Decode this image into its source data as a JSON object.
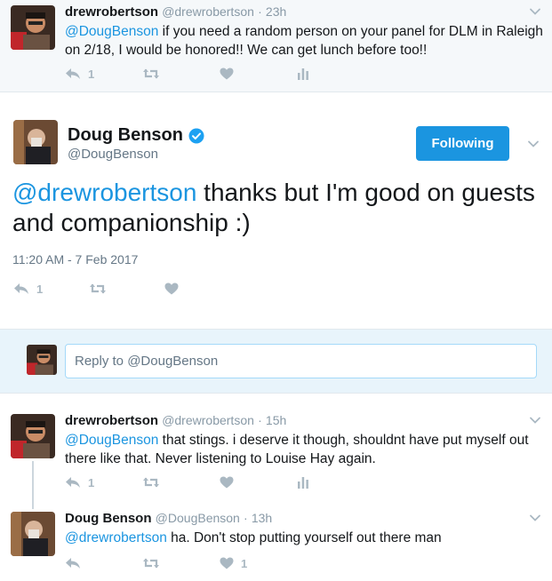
{
  "reply_top": {
    "name": "drewrobertson",
    "handle": "@drewrobertson",
    "dot": "·",
    "time": "23h",
    "mention": "@DougBenson",
    "text": " if you need a random person on your panel for DLM in Raleigh on 2/18, I would be honored!! We can get lunch before too!!",
    "reply_count": "1",
    "retweet_count": "",
    "like_count": ""
  },
  "main_tweet": {
    "name": "Doug Benson",
    "handle": "@DougBenson",
    "follow_label": "Following",
    "mention": "@drewrobertson",
    "text": " thanks but I'm good on guests and companionship :)",
    "timestamp": "11:20 AM - 7 Feb 2017",
    "reply_count": "1",
    "retweet_count": "",
    "like_count": ""
  },
  "reply_box": {
    "placeholder": "Reply to @DougBenson"
  },
  "reply_2": {
    "name": "drewrobertson",
    "handle": "@drewrobertson",
    "dot": "·",
    "time": "15h",
    "mention": "@DougBenson",
    "text": " that stings. i deserve it though, shouldnt have put myself out there like that. Never listening to Louise Hay again.",
    "reply_count": "1",
    "retweet_count": "",
    "like_count": ""
  },
  "reply_3": {
    "name": "Doug Benson",
    "handle": "@DougBenson",
    "dot": "·",
    "time": "13h",
    "mention": "@drewrobertson",
    "text": " ha. Don't stop putting yourself out there man",
    "reply_count": "",
    "retweet_count": "",
    "like_count": "1"
  },
  "colors": {
    "accent": "#1b95e0",
    "icon_gray": "#aab8c2",
    "muted": "#657786",
    "reply_bg": "#e8f4fb"
  },
  "icons": [
    "reply-icon",
    "retweet-icon",
    "like-icon",
    "analytics-icon",
    "chevron-down-icon",
    "verified-icon"
  ]
}
